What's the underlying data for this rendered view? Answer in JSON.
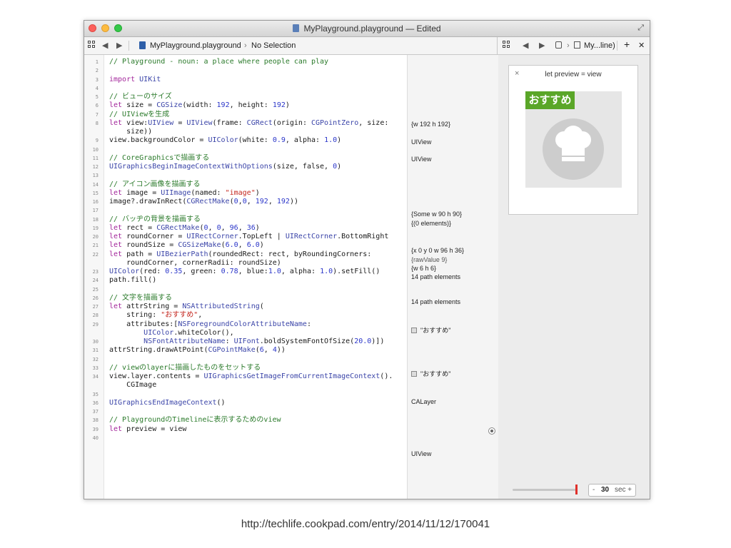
{
  "window": {
    "title": "MyPlayground.playground — Edited"
  },
  "toolbar": {
    "file": "MyPlayground.playground",
    "separator": "›",
    "selection": "No Selection",
    "assistant_title": "My...line)",
    "add": "+",
    "close": "✕"
  },
  "code_lines": [
    {
      "n": "1",
      "t": "// Playground - noun: a place where people can play"
    },
    {
      "n": "2",
      "t": ""
    },
    {
      "n": "3",
      "t": "import UIKit"
    },
    {
      "n": "4",
      "t": ""
    },
    {
      "n": "5",
      "t": "// ビューのサイズ"
    },
    {
      "n": "6",
      "t": "let size = CGSize(width: 192, height: 192)"
    },
    {
      "n": "7",
      "t": "// UIViewを生成"
    },
    {
      "n": "8",
      "t": "let view:UIView = UIView(frame: CGRect(origin: CGPointZero, size:"
    },
    {
      "n": "",
      "t": "    size))"
    },
    {
      "n": "9",
      "t": "view.backgroundColor = UIColor(white: 0.9, alpha: 1.0)"
    },
    {
      "n": "10",
      "t": ""
    },
    {
      "n": "11",
      "t": "// CoreGraphicsで描画する"
    },
    {
      "n": "12",
      "t": "UIGraphicsBeginImageContextWithOptions(size, false, 0)"
    },
    {
      "n": "13",
      "t": ""
    },
    {
      "n": "14",
      "t": "// アイコン画像を描画する"
    },
    {
      "n": "15",
      "t": "let image = UIImage(named: \"image\")"
    },
    {
      "n": "16",
      "t": "image?.drawInRect(CGRectMake(0,0, 192, 192))"
    },
    {
      "n": "17",
      "t": ""
    },
    {
      "n": "18",
      "t": "// バッヂの背景を描画する"
    },
    {
      "n": "19",
      "t": "let rect = CGRectMake(0, 0, 96, 36)"
    },
    {
      "n": "20",
      "t": "let roundCorner = UIRectCorner.TopLeft | UIRectCorner.BottomRight"
    },
    {
      "n": "21",
      "t": "let roundSize = CGSizeMake(6.0, 6.0)"
    },
    {
      "n": "22",
      "t": "let path = UIBezierPath(roundedRect: rect, byRoundingCorners:"
    },
    {
      "n": "",
      "t": "    roundCorner, cornerRadii: roundSize)"
    },
    {
      "n": "23",
      "t": "UIColor(red: 0.35, green: 0.78, blue:1.0, alpha: 1.0).setFill()"
    },
    {
      "n": "24",
      "t": "path.fill()"
    },
    {
      "n": "25",
      "t": ""
    },
    {
      "n": "26",
      "t": "// 文字を描画する"
    },
    {
      "n": "27",
      "t": "let attrString = NSAttributedString("
    },
    {
      "n": "28",
      "t": "    string: \"おすすめ\","
    },
    {
      "n": "29",
      "t": "    attributes:[NSForegroundColorAttributeName:"
    },
    {
      "n": "",
      "t": "        UIColor.whiteColor(),"
    },
    {
      "n": "30",
      "t": "        NSFontAttributeName: UIFont.boldSystemFontOfSize(20.0)])"
    },
    {
      "n": "31",
      "t": "attrString.drawAtPoint(CGPointMake(6, 4))"
    },
    {
      "n": "32",
      "t": ""
    },
    {
      "n": "33",
      "t": "// viewのlayerに描画したものをセットする"
    },
    {
      "n": "34",
      "t": "view.layer.contents = UIGraphicsGetImageFromCurrentImageContext()."
    },
    {
      "n": "",
      "t": "    CGImage"
    },
    {
      "n": "35",
      "t": ""
    },
    {
      "n": "36",
      "t": "UIGraphicsEndImageContext()"
    },
    {
      "n": "37",
      "t": ""
    },
    {
      "n": "38",
      "t": "// PlaygroundのTimelineに表示するためのview"
    },
    {
      "n": "39",
      "t": "let preview = view"
    },
    {
      "n": "40",
      "t": ""
    }
  ],
  "results": {
    "r6": "{w 192 h 192}",
    "r8": "UIView",
    "r9": "UIView",
    "r15": "{Some w 90 h 90}",
    "r16": "{(0 elements)}",
    "r19": "{x 0 y 0 w 96 h 36}",
    "r20": "{rawValue 9}",
    "r21": "{w 6 h 6}",
    "r22": "14 path elements",
    "r24": "14 path elements",
    "r27": "\"おすすめ\"",
    "r31": "\"おすすめ\"",
    "r34": "CALayer",
    "r39": "UIView"
  },
  "timeline": {
    "card_title": "let preview = view",
    "card_close": "×",
    "badge_text": "おすすめ",
    "badge_color": "#5aa628",
    "duration_value": "30",
    "duration_unit": "sec",
    "minus": "-",
    "plus": "+"
  },
  "caption": "http://techlife.cookpad.com/entry/2014/11/12/170041"
}
